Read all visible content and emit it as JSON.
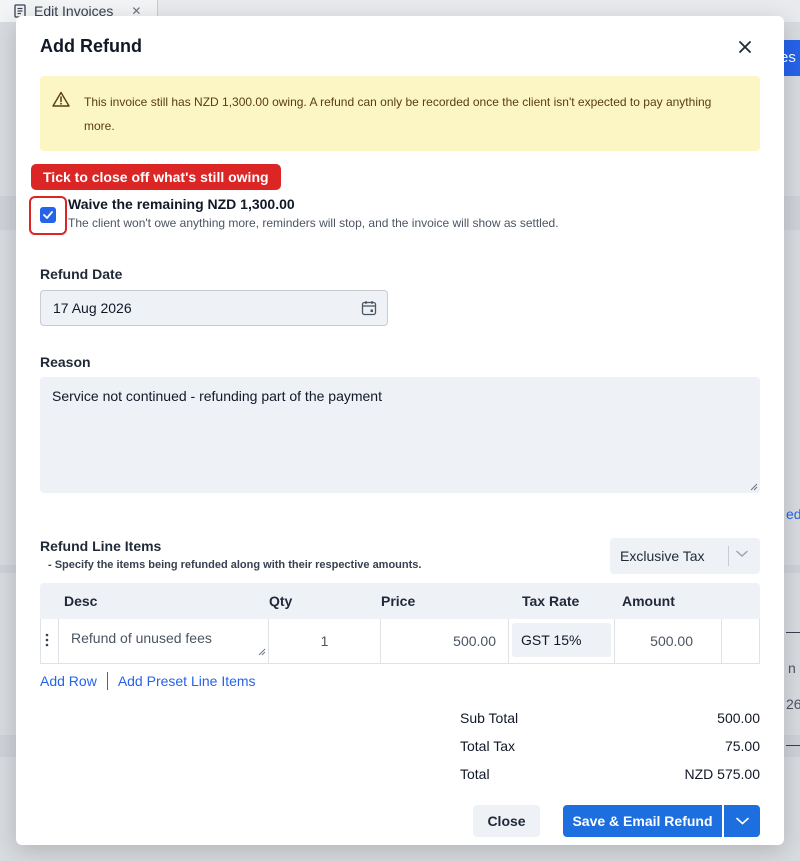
{
  "background": {
    "tab_title": "Edit Invoices",
    "right_button_partial": "es",
    "right_text_partial_1": "ed",
    "right_text_partial_2": "n",
    "right_text_partial_3": "26"
  },
  "modal": {
    "title": "Add Refund",
    "alert_text": "This invoice still has NZD 1,300.00 owing. A refund can only be recorded once the client isn't expected to pay anything more.",
    "tooltip": "Tick to close off what's still owing",
    "waive": {
      "checked": true,
      "title": "Waive the remaining NZD 1,300.00",
      "subtitle": "The client won't owe anything more, reminders will stop, and the invoice will show as settled."
    },
    "refund_date": {
      "label": "Refund Date",
      "value": "17 Aug 2026"
    },
    "reason": {
      "label": "Reason",
      "value": "Service not continued - refunding part of the payment"
    },
    "line_items": {
      "title": "Refund Line Items",
      "subtitle": "- Specify the items being refunded along with their respective amounts.",
      "tax_mode": "Exclusive Tax",
      "columns": [
        "Desc",
        "Qty",
        "Price",
        "Tax Rate",
        "Amount"
      ],
      "rows": [
        {
          "desc": "Refund of unused fees",
          "qty": "1",
          "price": "500.00",
          "tax_rate": "GST 15%",
          "amount": "500.00"
        }
      ],
      "add_row": "Add Row",
      "add_preset": "Add Preset Line Items"
    },
    "totals": {
      "sub_total_label": "Sub Total",
      "sub_total": "500.00",
      "total_tax_label": "Total Tax",
      "total_tax": "75.00",
      "total_label": "Total",
      "total": "NZD 575.00"
    },
    "buttons": {
      "close": "Close",
      "save": "Save & Email Refund"
    }
  },
  "colors": {
    "primary": "#1d6fe0",
    "alert_bg": "#fcf6c4",
    "tooltip_bg": "#dc2626"
  }
}
